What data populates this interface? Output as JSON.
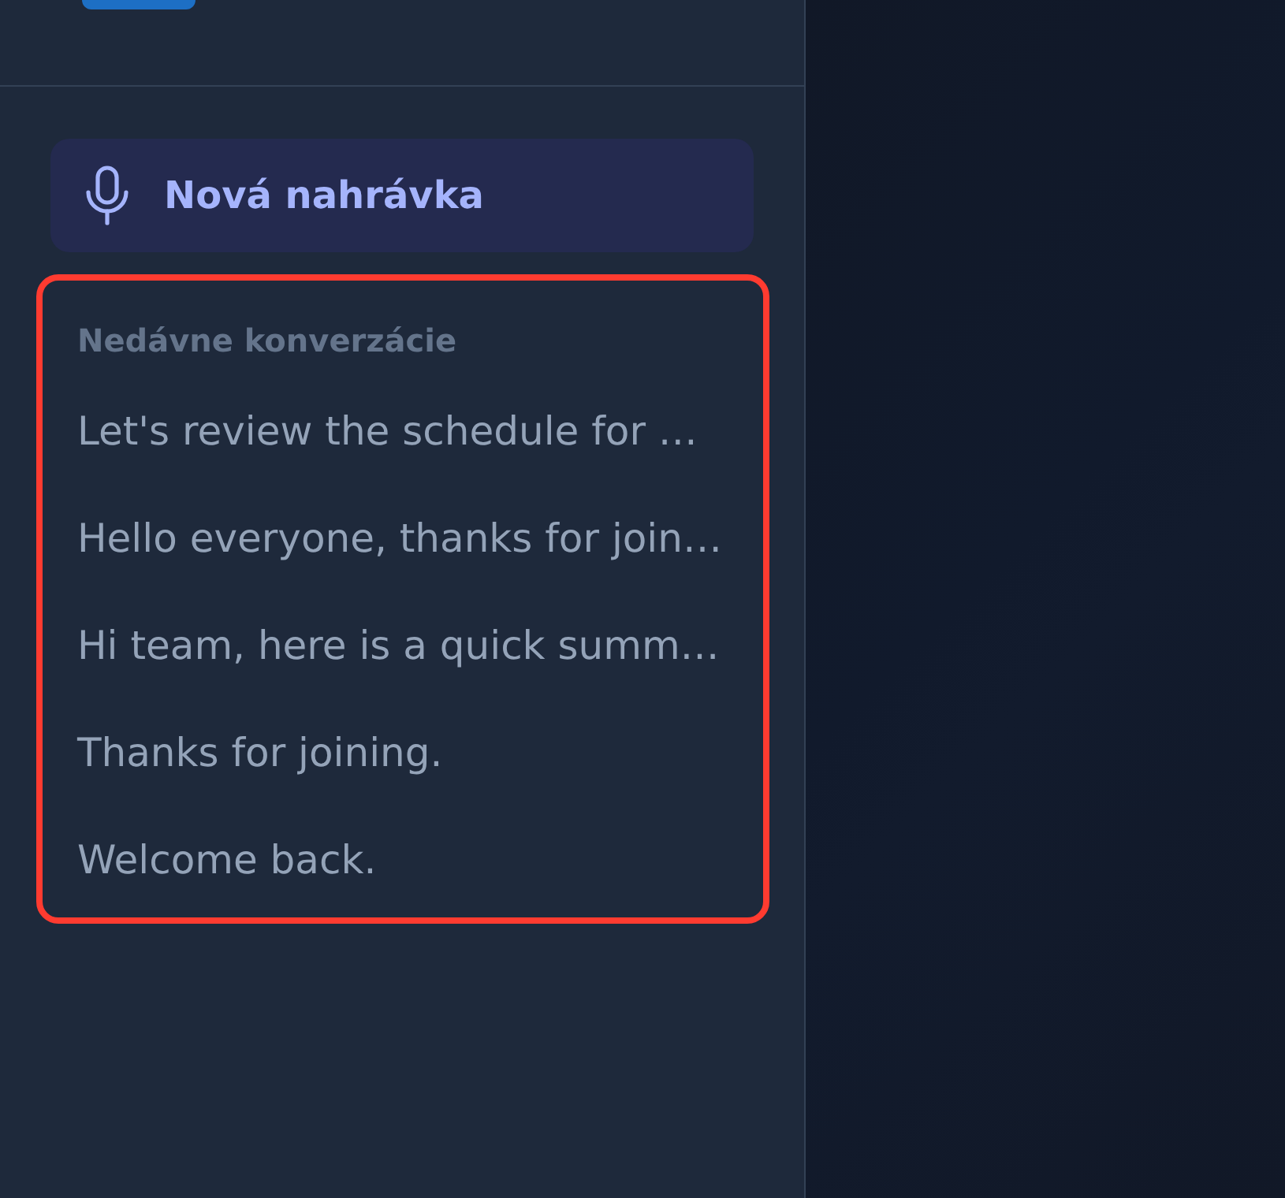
{
  "sidebar": {
    "new_recording_button": {
      "label": "Nová nahrávka"
    },
    "recent": {
      "highlighted": true,
      "heading": "Nedávne konverzácie",
      "items": [
        {
          "title": "Let's review the schedule for …"
        },
        {
          "title": "Hello everyone, thanks for join…"
        },
        {
          "title": "Hi team, here is a quick summ…"
        },
        {
          "title": "Thanks for joining."
        },
        {
          "title": "Welcome back."
        }
      ]
    }
  }
}
